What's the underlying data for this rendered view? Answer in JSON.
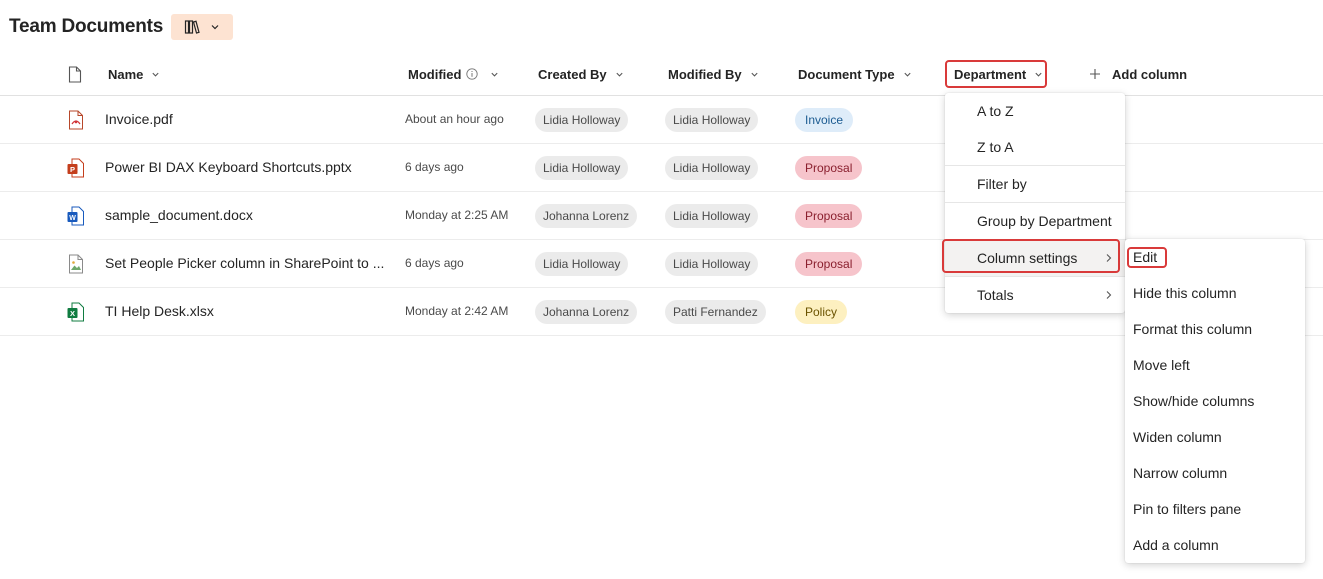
{
  "library": {
    "title": "Team Documents",
    "view_icon": "library-books-icon"
  },
  "columns": {
    "name": "Name",
    "modified": "Modified",
    "created_by": "Created By",
    "modified_by": "Modified By",
    "document_type": "Document Type",
    "department": "Department",
    "add_column": "Add column"
  },
  "rows": [
    {
      "name": "Invoice.pdf",
      "icon": "pdf-file-icon",
      "modified": "About an hour ago",
      "created_by": "Lidia Holloway",
      "modified_by": "Lidia Holloway",
      "type": "Invoice"
    },
    {
      "name": "Power BI DAX Keyboard Shortcuts.pptx",
      "icon": "powerpoint-file-icon",
      "modified": "6 days ago",
      "created_by": "Lidia Holloway",
      "modified_by": "Lidia Holloway",
      "type": "Proposal"
    },
    {
      "name": "sample_document.docx",
      "icon": "word-file-icon",
      "modified": "Monday at 2:25 AM",
      "created_by": "Johanna Lorenz",
      "modified_by": "Lidia Holloway",
      "type": "Proposal"
    },
    {
      "name": "Set People Picker column in SharePoint to ...",
      "icon": "image-file-icon",
      "modified": "6 days ago",
      "created_by": "Lidia Holloway",
      "modified_by": "Lidia Holloway",
      "type": "Proposal"
    },
    {
      "name": "TI Help Desk.xlsx",
      "icon": "excel-file-icon",
      "modified": "Monday at 2:42 AM",
      "created_by": "Johanna Lorenz",
      "modified_by": "Patti Fernandez",
      "type": "Policy"
    }
  ],
  "type_colors": {
    "Invoice": {
      "bg": "#deecf9",
      "fg": "#1b5b91"
    },
    "Proposal": {
      "bg": "#f6c4cb",
      "fg": "#8a1f2e"
    },
    "Policy": {
      "bg": "#fdf0c0",
      "fg": "#6b5300"
    }
  },
  "column_menu": {
    "items": [
      "A to Z",
      "Z to A",
      "Filter by",
      "Group by Department",
      "Column settings",
      "Totals"
    ]
  },
  "settings_submenu": {
    "items": [
      "Edit",
      "Hide this column",
      "Format this column",
      "Move left",
      "Show/hide columns",
      "Widen column",
      "Narrow column",
      "Pin to filters pane",
      "Add a column"
    ]
  },
  "highlight_color": "#d93a3a"
}
